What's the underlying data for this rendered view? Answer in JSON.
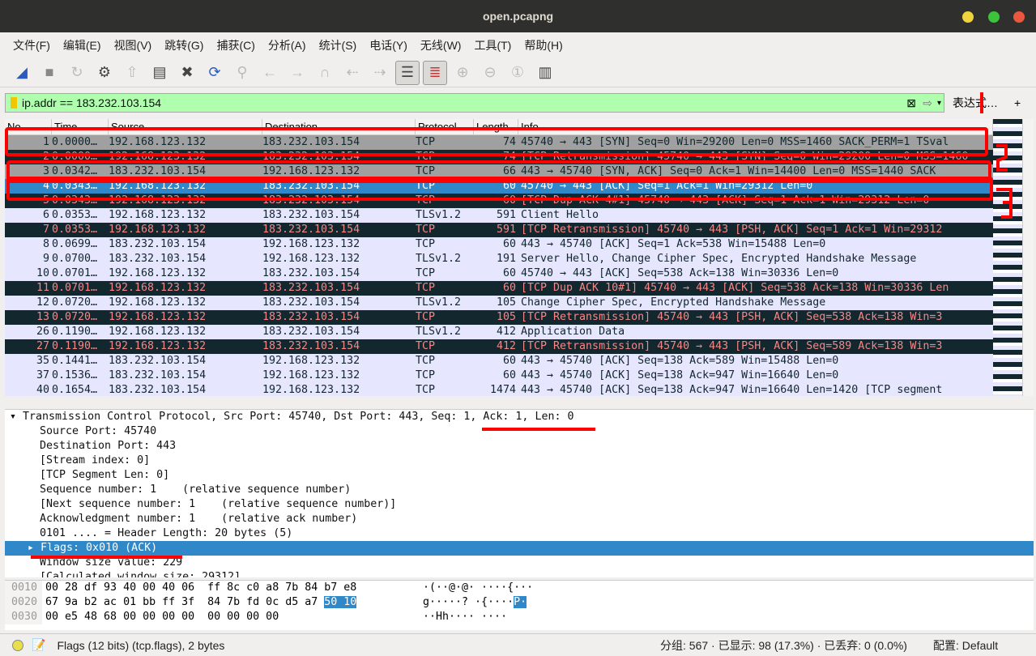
{
  "window": {
    "title": "open.pcapng"
  },
  "menu": [
    "文件(F)",
    "编辑(E)",
    "视图(V)",
    "跳转(G)",
    "捕获(C)",
    "分析(A)",
    "统计(S)",
    "电话(Y)",
    "无线(W)",
    "工具(T)",
    "帮助(H)"
  ],
  "filter": {
    "value": "ip.addr == 183.232.103.154",
    "expression_label": "表达式…",
    "add_label": "+"
  },
  "columns": [
    "No.",
    "Time",
    "Source",
    "Destination",
    "Protocol",
    "Length",
    "Info"
  ],
  "packets": [
    {
      "no": "1",
      "time": "0.0000…",
      "src": "192.168.123.132",
      "dst": "183.232.103.154",
      "proto": "TCP",
      "len": "74",
      "info": "45740 → 443 [SYN] Seq=0 Win=29200 Len=0 MSS=1460 SACK_PERM=1 TSval",
      "style": "gray"
    },
    {
      "no": "2",
      "time": "0.0000…",
      "src": "192.168.123.132",
      "dst": "183.232.103.154",
      "proto": "TCP",
      "len": "74",
      "info": "[TCP Retransmission] 45740 → 443 [SYN] Seq=0 Win=29200 Len=0 MSS=1460",
      "style": "dark"
    },
    {
      "no": "3",
      "time": "0.0342…",
      "src": "183.232.103.154",
      "dst": "192.168.123.132",
      "proto": "TCP",
      "len": "66",
      "info": "443 → 45740 [SYN, ACK] Seq=0 Ack=1 Win=14400 Len=0 MSS=1440 SACK",
      "style": "gray"
    },
    {
      "no": "4",
      "time": "0.0343…",
      "src": "192.168.123.132",
      "dst": "183.232.103.154",
      "proto": "TCP",
      "len": "60",
      "info": "45740 → 443 [ACK] Seq=1 Ack=1 Win=29312 Len=0",
      "style": "sel"
    },
    {
      "no": "5",
      "time": "0.0343…",
      "src": "192.168.123.132",
      "dst": "183.232.103.154",
      "proto": "TCP",
      "len": "60",
      "info": "[TCP Dup ACK 4#1] 45740 → 443 [ACK] Seq=1 Ack=1 Win=29312 Len=0",
      "style": "dark"
    },
    {
      "no": "6",
      "time": "0.0353…",
      "src": "192.168.123.132",
      "dst": "183.232.103.154",
      "proto": "TLSv1.2",
      "len": "591",
      "info": "Client Hello",
      "style": "light"
    },
    {
      "no": "7",
      "time": "0.0353…",
      "src": "192.168.123.132",
      "dst": "183.232.103.154",
      "proto": "TCP",
      "len": "591",
      "info": "[TCP Retransmission] 45740 → 443 [PSH, ACK] Seq=1 Ack=1 Win=29312",
      "style": "dark"
    },
    {
      "no": "8",
      "time": "0.0699…",
      "src": "183.232.103.154",
      "dst": "192.168.123.132",
      "proto": "TCP",
      "len": "60",
      "info": "443 → 45740 [ACK] Seq=1 Ack=538 Win=15488 Len=0",
      "style": "light"
    },
    {
      "no": "9",
      "time": "0.0700…",
      "src": "183.232.103.154",
      "dst": "192.168.123.132",
      "proto": "TLSv1.2",
      "len": "191",
      "info": "Server Hello, Change Cipher Spec, Encrypted Handshake Message",
      "style": "light"
    },
    {
      "no": "10",
      "time": "0.0701…",
      "src": "192.168.123.132",
      "dst": "183.232.103.154",
      "proto": "TCP",
      "len": "60",
      "info": "45740 → 443 [ACK] Seq=538 Ack=138 Win=30336 Len=0",
      "style": "light"
    },
    {
      "no": "11",
      "time": "0.0701…",
      "src": "192.168.123.132",
      "dst": "183.232.103.154",
      "proto": "TCP",
      "len": "60",
      "info": "[TCP Dup ACK 10#1] 45740 → 443 [ACK] Seq=538 Ack=138 Win=30336 Len",
      "style": "dark"
    },
    {
      "no": "12",
      "time": "0.0720…",
      "src": "192.168.123.132",
      "dst": "183.232.103.154",
      "proto": "TLSv1.2",
      "len": "105",
      "info": "Change Cipher Spec, Encrypted Handshake Message",
      "style": "light"
    },
    {
      "no": "13",
      "time": "0.0720…",
      "src": "192.168.123.132",
      "dst": "183.232.103.154",
      "proto": "TCP",
      "len": "105",
      "info": "[TCP Retransmission] 45740 → 443 [PSH, ACK] Seq=538 Ack=138 Win=3",
      "style": "dark"
    },
    {
      "no": "26",
      "time": "0.1190…",
      "src": "192.168.123.132",
      "dst": "183.232.103.154",
      "proto": "TLSv1.2",
      "len": "412",
      "info": "Application Data",
      "style": "light"
    },
    {
      "no": "27",
      "time": "0.1190…",
      "src": "192.168.123.132",
      "dst": "183.232.103.154",
      "proto": "TCP",
      "len": "412",
      "info": "[TCP Retransmission] 45740 → 443 [PSH, ACK] Seq=589 Ack=138 Win=3",
      "style": "dark"
    },
    {
      "no": "35",
      "time": "0.1441…",
      "src": "183.232.103.154",
      "dst": "192.168.123.132",
      "proto": "TCP",
      "len": "60",
      "info": "443 → 45740 [ACK] Seq=138 Ack=589 Win=15488 Len=0",
      "style": "light"
    },
    {
      "no": "37",
      "time": "0.1536…",
      "src": "183.232.103.154",
      "dst": "192.168.123.132",
      "proto": "TCP",
      "len": "60",
      "info": "443 → 45740 [ACK] Seq=138 Ack=947 Win=16640 Len=0",
      "style": "light"
    },
    {
      "no": "40",
      "time": "0.1654…",
      "src": "183.232.103.154",
      "dst": "192.168.123.132",
      "proto": "TCP",
      "len": "1474",
      "info": "443 → 45740 [ACK] Seq=138 Ack=947 Win=16640 Len=1420 [TCP segment",
      "style": "light"
    }
  ],
  "details": {
    "header": "Transmission Control Protocol, Src Port: 45740, Dst Port: 443, Seq: 1, Ack: 1, Len: 0",
    "lines": [
      "Source Port: 45740",
      "Destination Port: 443",
      "[Stream index: 0]",
      "[TCP Segment Len: 0]",
      "Sequence number: 1    (relative sequence number)",
      "[Next sequence number: 1    (relative sequence number)]",
      "Acknowledgment number: 1    (relative ack number)",
      "0101 .... = Header Length: 20 bytes (5)"
    ],
    "flags": "Flags: 0x010 (ACK)",
    "after": [
      "Window size value: 229",
      "[Calculated window size: 29312]"
    ]
  },
  "hex": [
    {
      "offset": "0010",
      "bytes": "00 28 df 93 40 00 40 06  ff 8c c0 a8 7b 84 b7 e8",
      "hl": "",
      "ascii": "·(··@·@· ····{···",
      "ahl": ""
    },
    {
      "offset": "0020",
      "bytes": "67 9a b2 ac 01 bb ff 3f  84 7b fd 0c d5 a7 ",
      "hl": "50 10",
      "ascii": "g·····? ·{····",
      "ahl": "P·"
    },
    {
      "offset": "0030",
      "bytes": "00 e5 48 68 00 00 00 00  00 00 00 00",
      "hl": "",
      "ascii": "··Hh···· ····",
      "ahl": ""
    }
  ],
  "status": {
    "field": "Flags (12 bits) (tcp.flags), 2 bytes",
    "counts": "分组: 567 · 已显示: 98 (17.3%) · 已丢弃: 0 (0.0%)",
    "profile": "配置: Default"
  },
  "colors": {
    "selected": "#3188c8",
    "annotation": "#ff0000",
    "filter_ok": "#afffaf"
  }
}
